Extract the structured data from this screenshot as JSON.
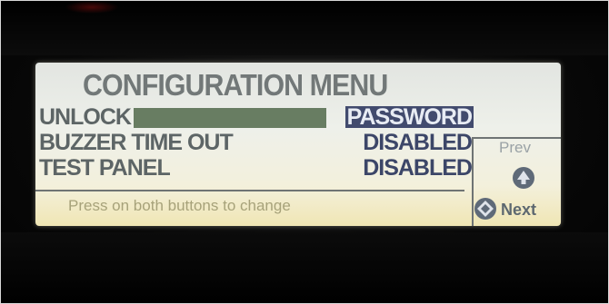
{
  "screen": {
    "title": "CONFIGURATION MENU",
    "rows": [
      {
        "label": "UNLOCK",
        "value": "PASSWORD",
        "selected": true
      },
      {
        "label": "BUZZER TIME OUT",
        "value": "DISABLED",
        "selected": false
      },
      {
        "label": "TEST PANEL",
        "value": "DISABLED",
        "selected": false
      }
    ],
    "hint": "Press on both buttons to change",
    "nav": {
      "prev_label": "Prev",
      "next_label": "Next",
      "prev_icon": "up-arrow-icon",
      "next_icon": "diamond-arrow-icon"
    }
  },
  "colors": {
    "screen_backlight": "#eef0ea",
    "selected_bg": "#424b6e",
    "highlight_bar": "#687d62"
  }
}
